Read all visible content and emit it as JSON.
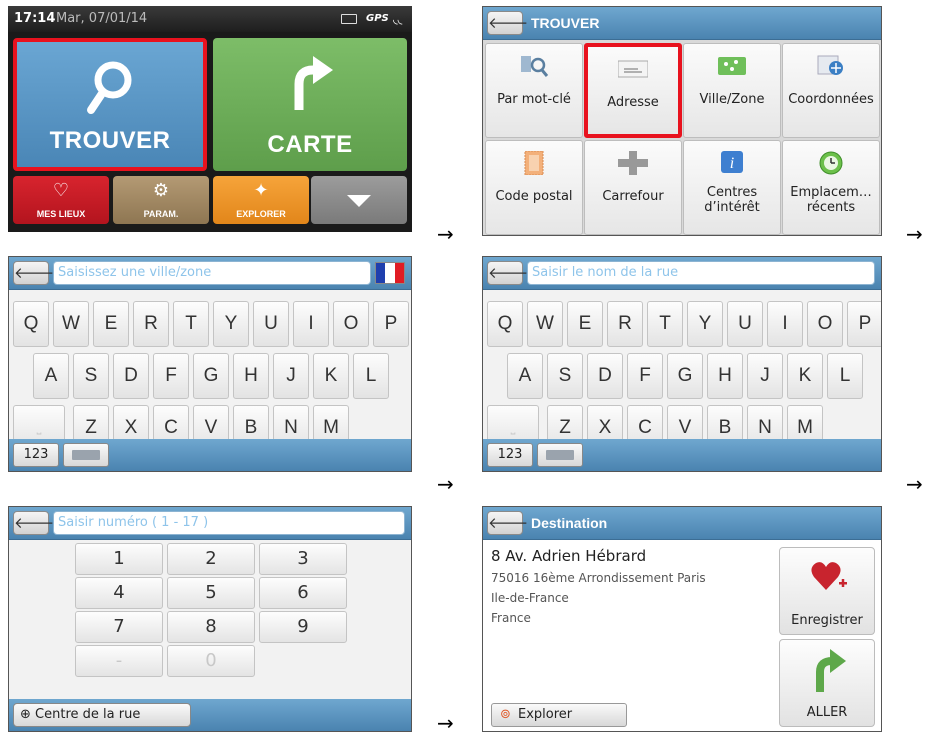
{
  "screen_main": {
    "status": {
      "time": "17:14",
      "date": "Mar, 07/01/14",
      "gps": "GPS"
    },
    "trouver": "TROUVER",
    "carte": "CARTE",
    "mes_lieux": "MES LIEUX",
    "param": "PARAM.",
    "explorer": "EXPLORER"
  },
  "screen_find": {
    "title": "TROUVER",
    "tiles": [
      {
        "label": "Par mot-clé",
        "icon": "keyword-search-icon"
      },
      {
        "label": "Adresse",
        "icon": "address-envelope-icon"
      },
      {
        "label": "Ville/Zone",
        "icon": "city-zone-icon"
      },
      {
        "label": "Coordonnées",
        "icon": "coordinates-icon"
      },
      {
        "label": "Code postal",
        "icon": "postal-code-icon"
      },
      {
        "label": "Carrefour",
        "icon": "crossroad-icon"
      },
      {
        "label": "Centres",
        "label2": "d’intérêt",
        "icon": "info-icon"
      },
      {
        "label": "Emplacem…",
        "label2": "récents",
        "icon": "clock-icon"
      }
    ],
    "selected": "Adresse"
  },
  "screen_city": {
    "placeholder": "Saisissez une ville/zone",
    "row1": [
      "Q",
      "W",
      "E",
      "R",
      "T",
      "Y",
      "U",
      "I",
      "O",
      "P"
    ],
    "row2": [
      "A",
      "S",
      "D",
      "F",
      "G",
      "H",
      "J",
      "K",
      "L"
    ],
    "row3": [
      "Z",
      "X",
      "C",
      "V",
      "B",
      "N",
      "M"
    ],
    "space": "⎵",
    "mode": "123",
    "flag_colors": [
      "#1f3fae",
      "#ffffff",
      "#e01c24"
    ]
  },
  "screen_street": {
    "placeholder": "Saisir le nom de la rue",
    "mode": "123"
  },
  "screen_number": {
    "placeholder": "Saisir numéro ( 1 - 17 )",
    "keys": [
      [
        "1",
        "2",
        "3"
      ],
      [
        "4",
        "5",
        "6"
      ],
      [
        "7",
        "8",
        "9"
      ],
      [
        "-",
        "0"
      ]
    ],
    "street_center": "Centre de la rue"
  },
  "screen_dest": {
    "title": "Destination",
    "line1": "8 Av. Adrien Hébrard",
    "line2": "75016 16ème Arrondissement Paris",
    "line3": "Ile-de-France",
    "line4": "France",
    "save": "Enregistrer",
    "go": "ALLER",
    "explore": "Explorer"
  },
  "flow_arrow": "→",
  "colors": {
    "accent": "#4a86b6",
    "selection": "#e8121e",
    "go_green": "#5ea84a",
    "heart": "#c8242e"
  }
}
